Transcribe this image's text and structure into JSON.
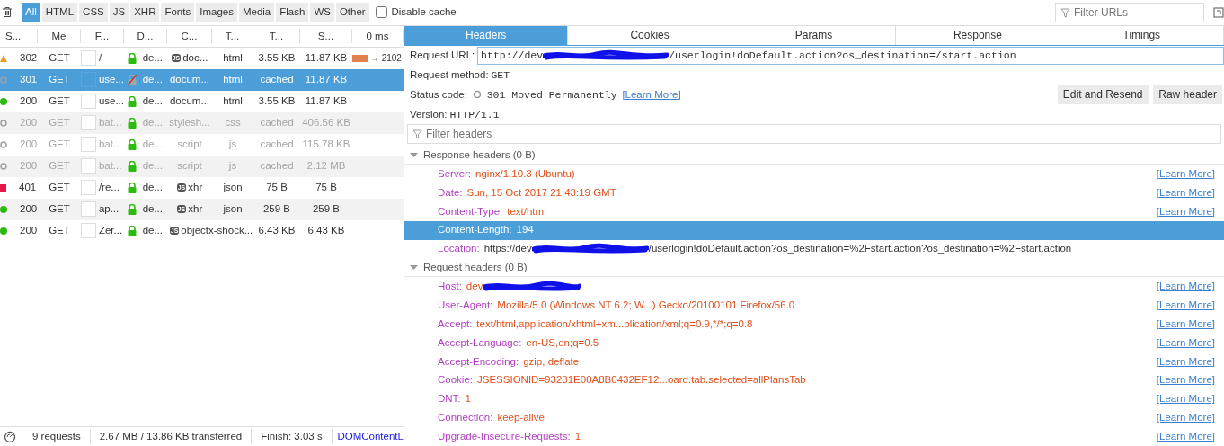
{
  "filter_buttons": [
    {
      "label": "All",
      "selected": true
    },
    {
      "label": "HTML",
      "selected": false
    },
    {
      "label": "CSS",
      "selected": false
    },
    {
      "label": "JS",
      "selected": false
    },
    {
      "label": "XHR",
      "selected": false
    },
    {
      "label": "Fonts",
      "selected": false
    },
    {
      "label": "Images",
      "selected": false
    },
    {
      "label": "Media",
      "selected": false
    },
    {
      "label": "Flash",
      "selected": false
    },
    {
      "label": "WS",
      "selected": false
    },
    {
      "label": "Other",
      "selected": false
    }
  ],
  "disable_cache": {
    "label": "Disable cache",
    "checked": false
  },
  "filter_urls": {
    "placeholder": "Filter URLs"
  },
  "columns": [
    "S...",
    "Me",
    "F...",
    "D...",
    "C...",
    "T...",
    "T...",
    "S...",
    "0 ms"
  ],
  "requests": [
    {
      "kind": "triangle",
      "color": "#e6a02a",
      "status": "302",
      "method": "GET",
      "file": "/",
      "lock_broken": false,
      "domain": "de...",
      "cause_badge": "JS",
      "cause": "doc...",
      "type": "html",
      "transferred": "3.55 KB",
      "size": "11.87 KB",
      "cached": false,
      "selected": false,
      "waterfall_bar": true,
      "waterfall_label": "→ 2102"
    },
    {
      "kind": "ring",
      "color": "#a0a0a0",
      "status": "301",
      "method": "GET",
      "file": "use...",
      "lock_broken": true,
      "domain": "de...",
      "cause": "docum...",
      "type": "html",
      "transferred": "cached",
      "size": "11.87 KB",
      "cached": true,
      "selected": true,
      "waterfall_bar": false
    },
    {
      "kind": "dot",
      "color": "#2cbb0f",
      "status": "200",
      "method": "GET",
      "file": "use...",
      "lock_broken": false,
      "domain": "de...",
      "cause": "docum...",
      "type": "html",
      "transferred": "3.55 KB",
      "size": "11.87 KB",
      "cached": false,
      "selected": false,
      "waterfall_bar": false
    },
    {
      "kind": "ring",
      "color": "#a0a0a0",
      "status": "200",
      "method": "GET",
      "file": "bat...",
      "lock_broken": false,
      "domain": "de...",
      "cause": "stylesh...",
      "type": "css",
      "transferred": "cached",
      "size": "406.56 KB",
      "cached": true,
      "selected": false,
      "waterfall_bar": false
    },
    {
      "kind": "ring",
      "color": "#a0a0a0",
      "status": "200",
      "method": "GET",
      "file": "bat...",
      "lock_broken": false,
      "domain": "de...",
      "cause": "script",
      "type": "js",
      "transferred": "cached",
      "size": "115.78 KB",
      "cached": true,
      "selected": false,
      "waterfall_bar": false
    },
    {
      "kind": "ring",
      "color": "#a0a0a0",
      "status": "200",
      "method": "GET",
      "file": "bat...",
      "lock_broken": false,
      "domain": "de...",
      "cause": "script",
      "type": "js",
      "transferred": "cached",
      "size": "2.12 MB",
      "cached": true,
      "selected": false,
      "waterfall_bar": false
    },
    {
      "kind": "square",
      "color": "#e8174a",
      "status": "401",
      "method": "GET",
      "file": "/re...",
      "lock_broken": false,
      "domain": "de...",
      "cause_badge": "JS",
      "cause": "xhr",
      "type": "json",
      "transferred": "75 B",
      "size": "75 B",
      "cached": false,
      "selected": false,
      "waterfall_bar": false
    },
    {
      "kind": "dot",
      "color": "#2cbb0f",
      "status": "200",
      "method": "GET",
      "file": "ap...",
      "lock_broken": false,
      "domain": "de...",
      "cause_badge": "JS",
      "cause": "xhr",
      "type": "json",
      "transferred": "259 B",
      "size": "259 B",
      "cached": false,
      "selected": false,
      "waterfall_bar": false
    },
    {
      "kind": "dot",
      "color": "#2cbb0f",
      "status": "200",
      "method": "GET",
      "file": "Zer...",
      "lock_broken": false,
      "domain": "de...",
      "cause_badge": "JS",
      "cause": "objectx-shock...",
      "transferred": "6.43 KB",
      "size": "6.43 KB",
      "cached": false,
      "selected": false,
      "waterfall_bar": false
    }
  ],
  "status_bar": [
    {
      "kind": "text",
      "text": "9 requests"
    },
    {
      "kind": "text",
      "text": "2.67 MB / 13.86 KB transferred"
    },
    {
      "kind": "text",
      "text": "Finish: 3.03 s"
    },
    {
      "kind": "link",
      "text": "DOMContentL"
    }
  ],
  "detail_tabs": [
    {
      "label": "Headers",
      "selected": true
    },
    {
      "label": "Cookies",
      "selected": false
    },
    {
      "label": "Params",
      "selected": false
    },
    {
      "label": "Response",
      "selected": false
    },
    {
      "label": "Timings",
      "selected": false
    }
  ],
  "request_url": {
    "label": "Request URL:",
    "value_parts": [
      "http://dev",
      "/userlogin!doDefault.action?os_destination=/start.action"
    ]
  },
  "request_method": {
    "label": "Request method:",
    "value": "GET"
  },
  "status_code": {
    "label": "Status code:",
    "value": "301 Moved Permanently",
    "link": "[Learn More]"
  },
  "action_buttons": [
    "Edit and Resend",
    "Raw header"
  ],
  "version": {
    "label": "Version:",
    "value": "HTTP/1.1"
  },
  "filter_headers": {
    "placeholder": "Filter headers"
  },
  "sections": [
    {
      "title": "Response headers (0 B)",
      "expanded": true,
      "items": [
        {
          "name": "Server:",
          "value_parts": [
            "nginx/1.10.3 (Ubuntu)"
          ],
          "redacted": false,
          "selected": false,
          "link": "[Learn More]"
        },
        {
          "name": "Date:",
          "value_parts": [
            "Sun, 15 Oct 2017 21:43:19 GMT"
          ],
          "redacted": false,
          "selected": false,
          "link": "[Learn More]"
        },
        {
          "name": "Content-Type:",
          "value_parts": [
            "text/html"
          ],
          "redacted": false,
          "selected": false,
          "link": "[Learn More]"
        },
        {
          "name": "Content-Length:",
          "value_parts": [
            "194"
          ],
          "redacted": false,
          "selected": true
        },
        {
          "name": "Location:",
          "value_parts": [
            "https://dev",
            "/userlogin!doDefault.action?os_destination=%2Fstart.action?os_destination=%2Fstart.action"
          ],
          "redacted": true,
          "plain": true,
          "selected": false
        }
      ]
    },
    {
      "title": "Request headers (0 B)",
      "expanded": true,
      "items": [
        {
          "name": "Host:",
          "value_parts": [
            "dev"
          ],
          "redacted": true,
          "selected": false,
          "link": "[Learn More]"
        },
        {
          "name": "User-Agent:",
          "value_parts": [
            "Mozilla/5.0 (Windows NT 6.2; W...) Gecko/20100101 Firefox/56.0"
          ],
          "redacted": false,
          "selected": false,
          "link": "[Learn More]"
        },
        {
          "name": "Accept:",
          "value_parts": [
            "text/html,application/xhtml+xm...plication/xml;q=0.9,*/*;q=0.8"
          ],
          "redacted": false,
          "selected": false,
          "link": "[Learn More]"
        },
        {
          "name": "Accept-Language:",
          "value_parts": [
            "en-US,en;q=0.5"
          ],
          "redacted": false,
          "selected": false,
          "link": "[Learn More]"
        },
        {
          "name": "Accept-Encoding:",
          "value_parts": [
            "gzip, deflate"
          ],
          "redacted": false,
          "selected": false,
          "link": "[Learn More]"
        },
        {
          "name": "Cookie:",
          "value_parts": [
            "JSESSIONID=93231E00A8B0432EF12...oard.tab.selected=allPlansTab"
          ],
          "redacted": false,
          "selected": false,
          "link": "[Learn More]"
        },
        {
          "name": "DNT:",
          "value_parts": [
            "1"
          ],
          "redacted": false,
          "selected": false,
          "link": "[Learn More]"
        },
        {
          "name": "Connection:",
          "value_parts": [
            "keep-alive"
          ],
          "redacted": false,
          "selected": false,
          "link": "[Learn More]"
        },
        {
          "name": "Upgrade-Insecure-Requests:",
          "value_parts": [
            "1"
          ],
          "redacted": false,
          "selected": false,
          "link": "[Learn More]"
        }
      ]
    }
  ]
}
